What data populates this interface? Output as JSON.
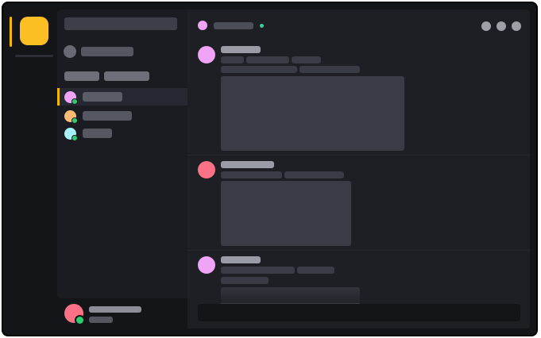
{
  "colors": {
    "brand": "#fbbf24",
    "online": "#2ecc71",
    "active_indicator": "#f5b800",
    "avatar_pink": "#f0a4f7",
    "avatar_peach": "#fdba74",
    "avatar_cyan": "#a5f3fc",
    "avatar_coral": "#fb7185"
  },
  "icons": {
    "server": "server-icon",
    "pinned": "pinned-avatar-icon",
    "header_actions": [
      "call-icon",
      "video-icon",
      "more-icon"
    ]
  },
  "sidebar": {
    "dms": [
      {
        "avatar_color": "#f0a4f7",
        "active": true,
        "online": true
      },
      {
        "avatar_color": "#fdba74",
        "active": false,
        "online": true
      },
      {
        "avatar_color": "#a5f3fc",
        "active": false,
        "online": true
      }
    ]
  },
  "messages": [
    {
      "avatar_color": "#f0a4f7",
      "has_attachment": true
    },
    {
      "avatar_color": "#fb7185",
      "has_attachment": true
    },
    {
      "avatar_color": "#f0a4f7",
      "has_attachment": true
    }
  ]
}
